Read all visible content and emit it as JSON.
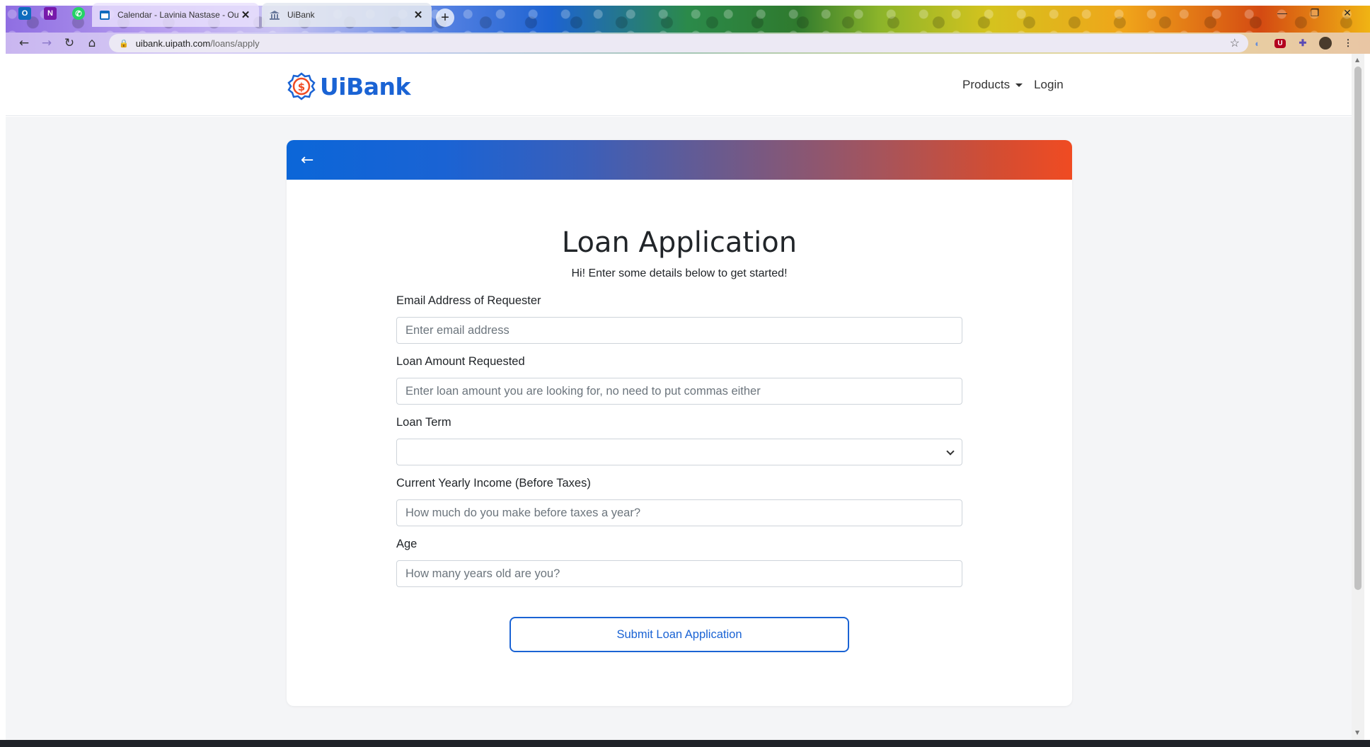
{
  "browser": {
    "pinned_tabs": [
      {
        "icon": "outlook-icon",
        "glyph": "O",
        "color": "#0f6cbd"
      },
      {
        "icon": "onenote-icon",
        "glyph": "N",
        "color": "#7719aa"
      },
      {
        "icon": "whatsapp-icon",
        "glyph": "✆",
        "color": "#25d366"
      }
    ],
    "tabs": [
      {
        "title": "Calendar - Lavinia Nastase - Outl",
        "icon": "calendar-icon",
        "active": false
      },
      {
        "title": "UiBank",
        "icon": "bank-icon",
        "active": true
      }
    ],
    "url_host": "uibank.uipath.com",
    "url_path": "/loans/apply"
  },
  "app": {
    "brand": "UiBank",
    "nav": {
      "products": "Products",
      "login": "Login"
    }
  },
  "form": {
    "title": "Loan Application",
    "subtitle": "Hi! Enter some details below to get started!",
    "email": {
      "label": "Email Address of Requester",
      "placeholder": "Enter email address"
    },
    "amount": {
      "label": "Loan Amount Requested",
      "placeholder": "Enter loan amount you are looking for, no need to put commas either"
    },
    "term": {
      "label": "Loan Term",
      "value": ""
    },
    "income": {
      "label": "Current Yearly Income (Before Taxes)",
      "placeholder": "How much do you make before taxes a year?"
    },
    "age": {
      "label": "Age",
      "placeholder": "How many years old are you?"
    },
    "submit": "Submit Loan Application"
  },
  "colors": {
    "brand_blue": "#1a63d4",
    "accent_orange": "#f04b22"
  }
}
